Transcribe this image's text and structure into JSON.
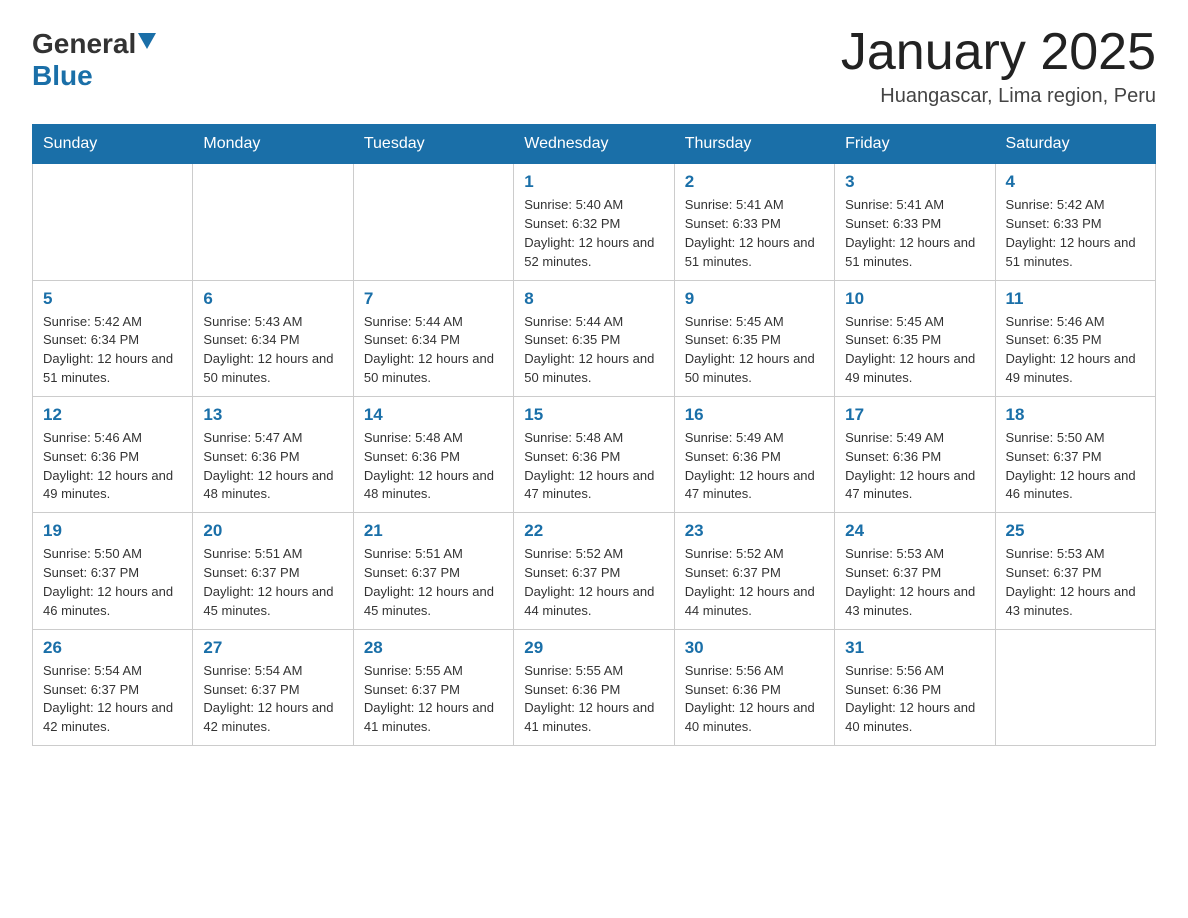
{
  "header": {
    "logo_general": "General",
    "logo_blue": "Blue",
    "title": "January 2025",
    "subtitle": "Huangascar, Lima region, Peru"
  },
  "weekdays": [
    "Sunday",
    "Monday",
    "Tuesday",
    "Wednesday",
    "Thursday",
    "Friday",
    "Saturday"
  ],
  "weeks": [
    [
      {
        "day": "",
        "info": ""
      },
      {
        "day": "",
        "info": ""
      },
      {
        "day": "",
        "info": ""
      },
      {
        "day": "1",
        "info": "Sunrise: 5:40 AM\nSunset: 6:32 PM\nDaylight: 12 hours and 52 minutes."
      },
      {
        "day": "2",
        "info": "Sunrise: 5:41 AM\nSunset: 6:33 PM\nDaylight: 12 hours and 51 minutes."
      },
      {
        "day": "3",
        "info": "Sunrise: 5:41 AM\nSunset: 6:33 PM\nDaylight: 12 hours and 51 minutes."
      },
      {
        "day": "4",
        "info": "Sunrise: 5:42 AM\nSunset: 6:33 PM\nDaylight: 12 hours and 51 minutes."
      }
    ],
    [
      {
        "day": "5",
        "info": "Sunrise: 5:42 AM\nSunset: 6:34 PM\nDaylight: 12 hours and 51 minutes."
      },
      {
        "day": "6",
        "info": "Sunrise: 5:43 AM\nSunset: 6:34 PM\nDaylight: 12 hours and 50 minutes."
      },
      {
        "day": "7",
        "info": "Sunrise: 5:44 AM\nSunset: 6:34 PM\nDaylight: 12 hours and 50 minutes."
      },
      {
        "day": "8",
        "info": "Sunrise: 5:44 AM\nSunset: 6:35 PM\nDaylight: 12 hours and 50 minutes."
      },
      {
        "day": "9",
        "info": "Sunrise: 5:45 AM\nSunset: 6:35 PM\nDaylight: 12 hours and 50 minutes."
      },
      {
        "day": "10",
        "info": "Sunrise: 5:45 AM\nSunset: 6:35 PM\nDaylight: 12 hours and 49 minutes."
      },
      {
        "day": "11",
        "info": "Sunrise: 5:46 AM\nSunset: 6:35 PM\nDaylight: 12 hours and 49 minutes."
      }
    ],
    [
      {
        "day": "12",
        "info": "Sunrise: 5:46 AM\nSunset: 6:36 PM\nDaylight: 12 hours and 49 minutes."
      },
      {
        "day": "13",
        "info": "Sunrise: 5:47 AM\nSunset: 6:36 PM\nDaylight: 12 hours and 48 minutes."
      },
      {
        "day": "14",
        "info": "Sunrise: 5:48 AM\nSunset: 6:36 PM\nDaylight: 12 hours and 48 minutes."
      },
      {
        "day": "15",
        "info": "Sunrise: 5:48 AM\nSunset: 6:36 PM\nDaylight: 12 hours and 47 minutes."
      },
      {
        "day": "16",
        "info": "Sunrise: 5:49 AM\nSunset: 6:36 PM\nDaylight: 12 hours and 47 minutes."
      },
      {
        "day": "17",
        "info": "Sunrise: 5:49 AM\nSunset: 6:36 PM\nDaylight: 12 hours and 47 minutes."
      },
      {
        "day": "18",
        "info": "Sunrise: 5:50 AM\nSunset: 6:37 PM\nDaylight: 12 hours and 46 minutes."
      }
    ],
    [
      {
        "day": "19",
        "info": "Sunrise: 5:50 AM\nSunset: 6:37 PM\nDaylight: 12 hours and 46 minutes."
      },
      {
        "day": "20",
        "info": "Sunrise: 5:51 AM\nSunset: 6:37 PM\nDaylight: 12 hours and 45 minutes."
      },
      {
        "day": "21",
        "info": "Sunrise: 5:51 AM\nSunset: 6:37 PM\nDaylight: 12 hours and 45 minutes."
      },
      {
        "day": "22",
        "info": "Sunrise: 5:52 AM\nSunset: 6:37 PM\nDaylight: 12 hours and 44 minutes."
      },
      {
        "day": "23",
        "info": "Sunrise: 5:52 AM\nSunset: 6:37 PM\nDaylight: 12 hours and 44 minutes."
      },
      {
        "day": "24",
        "info": "Sunrise: 5:53 AM\nSunset: 6:37 PM\nDaylight: 12 hours and 43 minutes."
      },
      {
        "day": "25",
        "info": "Sunrise: 5:53 AM\nSunset: 6:37 PM\nDaylight: 12 hours and 43 minutes."
      }
    ],
    [
      {
        "day": "26",
        "info": "Sunrise: 5:54 AM\nSunset: 6:37 PM\nDaylight: 12 hours and 42 minutes."
      },
      {
        "day": "27",
        "info": "Sunrise: 5:54 AM\nSunset: 6:37 PM\nDaylight: 12 hours and 42 minutes."
      },
      {
        "day": "28",
        "info": "Sunrise: 5:55 AM\nSunset: 6:37 PM\nDaylight: 12 hours and 41 minutes."
      },
      {
        "day": "29",
        "info": "Sunrise: 5:55 AM\nSunset: 6:36 PM\nDaylight: 12 hours and 41 minutes."
      },
      {
        "day": "30",
        "info": "Sunrise: 5:56 AM\nSunset: 6:36 PM\nDaylight: 12 hours and 40 minutes."
      },
      {
        "day": "31",
        "info": "Sunrise: 5:56 AM\nSunset: 6:36 PM\nDaylight: 12 hours and 40 minutes."
      },
      {
        "day": "",
        "info": ""
      }
    ]
  ]
}
